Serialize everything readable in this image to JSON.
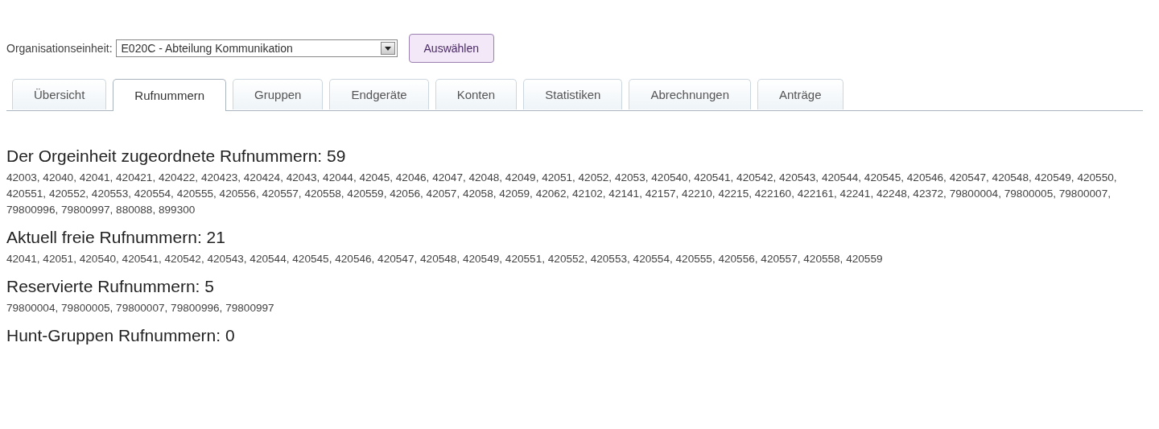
{
  "filter": {
    "label": "Organisationseinheit:",
    "value": "E020C - Abteilung Kommunikation",
    "button": "Auswählen"
  },
  "tabs": [
    {
      "label": "Übersicht",
      "selected": false
    },
    {
      "label": "Rufnummern",
      "selected": true
    },
    {
      "label": "Gruppen",
      "selected": false
    },
    {
      "label": "Endgeräte",
      "selected": false
    },
    {
      "label": "Konten",
      "selected": false
    },
    {
      "label": "Statistiken",
      "selected": false
    },
    {
      "label": "Abrechnungen",
      "selected": false
    },
    {
      "label": "Anträge",
      "selected": false
    }
  ],
  "sections": [
    {
      "heading": "Der Orgeinheit zugeordnete Rufnummern: 59",
      "numbers": "42003, 42040, 42041, 420421, 420422, 420423, 420424, 42043, 42044, 42045, 42046, 42047, 42048, 42049, 42051, 42052, 42053, 420540, 420541, 420542, 420543, 420544, 420545, 420546, 420547, 420548, 420549, 420550, 420551, 420552, 420553, 420554, 420555, 420556, 420557, 420558, 420559, 42056, 42057, 42058, 42059, 42062, 42102, 42141, 42157, 42210, 42215, 422160, 422161, 42241, 42248, 42372, 79800004, 79800005, 79800007, 79800996, 79800997, 880088, 899300"
    },
    {
      "heading": "Aktuell freie Rufnummern: 21",
      "numbers": "42041, 42051, 420540, 420541, 420542, 420543, 420544, 420545, 420546, 420547, 420548, 420549, 420551, 420552, 420553, 420554, 420555, 420556, 420557, 420558, 420559"
    },
    {
      "heading": "Reservierte Rufnummern: 5",
      "numbers": "79800004, 79800005, 79800007, 79800996, 79800997"
    },
    {
      "heading": "Hunt-Gruppen Rufnummern: 0"
    }
  ]
}
